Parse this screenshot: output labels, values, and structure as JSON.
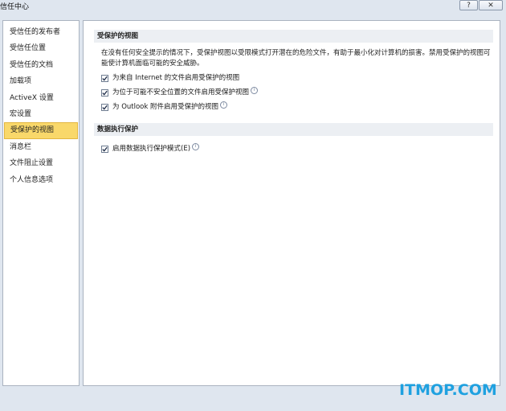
{
  "window": {
    "title": "信任中心",
    "help_glyph": "?",
    "close_glyph": "✕"
  },
  "sidebar": {
    "items": [
      {
        "label": "受信任的发布者",
        "active": false
      },
      {
        "label": "受信任位置",
        "active": false
      },
      {
        "label": "受信任的文档",
        "active": false
      },
      {
        "label": "加载项",
        "active": false
      },
      {
        "label": "ActiveX 设置",
        "active": false
      },
      {
        "label": "宏设置",
        "active": false
      },
      {
        "label": "受保护的视图",
        "active": true
      },
      {
        "label": "消息栏",
        "active": false
      },
      {
        "label": "文件阻止设置",
        "active": false
      },
      {
        "label": "个人信息选项",
        "active": false
      }
    ]
  },
  "main": {
    "protected_view": {
      "header": "受保护的视图",
      "description": "在没有任何安全提示的情况下，受保护视图以受限模式打开潜在的危险文件，有助于最小化对计算机的损害。禁用受保护的视图可能使计算机面临可能的安全威胁。",
      "options": [
        {
          "label": "为来自 Internet 的文件启用受保护的视图",
          "checked": true,
          "info": false
        },
        {
          "label": "为位于可能不安全位置的文件启用受保护视图",
          "checked": true,
          "info": true
        },
        {
          "label": "为 Outlook 附件启用受保护的视图",
          "checked": true,
          "info": true
        }
      ]
    },
    "dep": {
      "header": "数据执行保护",
      "options": [
        {
          "label": "启用数据执行保护模式(E)",
          "checked": true,
          "info": true
        }
      ]
    },
    "info_glyph": "i"
  },
  "watermark": "ITMOP.COM",
  "colors": {
    "active_item_bg": "#f9d86a",
    "window_bg": "#dfe6ef",
    "section_header_bg": "#eceff3",
    "watermark": "#1fa1e0"
  }
}
